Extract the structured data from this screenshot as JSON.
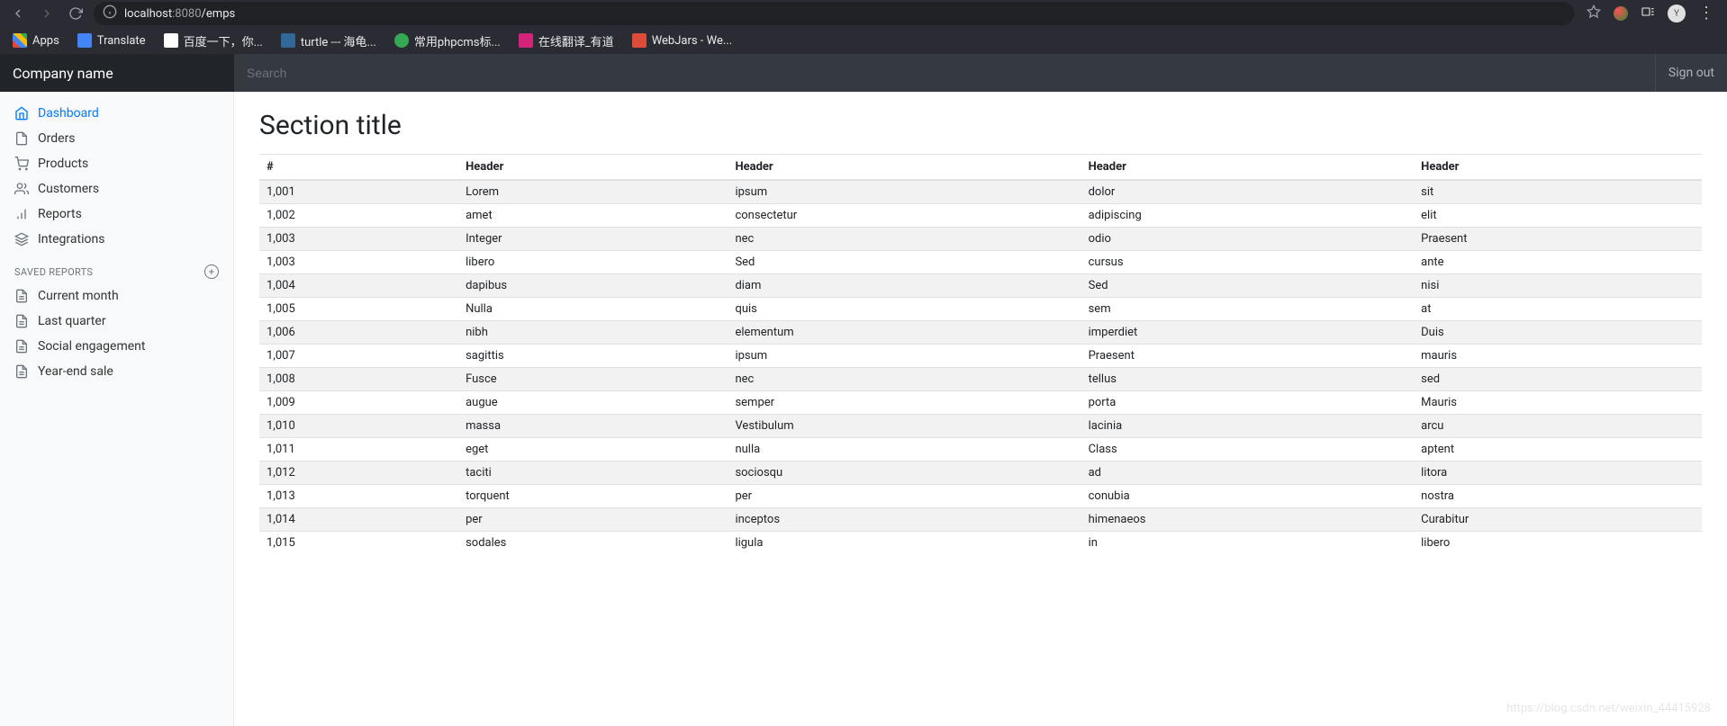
{
  "browser": {
    "url_host": "localhost",
    "url_port": ":8080",
    "url_path": "/emps",
    "bookmarks": [
      {
        "label": "Apps",
        "favicon": "fv-apps"
      },
      {
        "label": "Translate",
        "favicon": "fv-translate"
      },
      {
        "label": "百度一下，你...",
        "favicon": "fv-baidu"
      },
      {
        "label": "turtle --- 海龟...",
        "favicon": "fv-turtle"
      },
      {
        "label": "常用phpcms标...",
        "favicon": "fv-php"
      },
      {
        "label": "在线翻译_有道",
        "favicon": "fv-youdao"
      },
      {
        "label": "WebJars - We...",
        "favicon": "fv-webjars"
      }
    ]
  },
  "navbar": {
    "brand": "Company name",
    "search_placeholder": "Search",
    "signout": "Sign out"
  },
  "sidebar": {
    "main_nav": [
      {
        "label": "Dashboard",
        "icon": "home",
        "active": true
      },
      {
        "label": "Orders",
        "icon": "file",
        "active": false
      },
      {
        "label": "Products",
        "icon": "cart",
        "active": false
      },
      {
        "label": "Customers",
        "icon": "users",
        "active": false
      },
      {
        "label": "Reports",
        "icon": "bar-chart",
        "active": false
      },
      {
        "label": "Integrations",
        "icon": "layers",
        "active": false
      }
    ],
    "saved_heading": "SAVED REPORTS",
    "saved_reports": [
      {
        "label": "Current month"
      },
      {
        "label": "Last quarter"
      },
      {
        "label": "Social engagement"
      },
      {
        "label": "Year-end sale"
      }
    ]
  },
  "content": {
    "title": "Section title",
    "table": {
      "columns": [
        "#",
        "Header",
        "Header",
        "Header",
        "Header"
      ],
      "rows": [
        [
          "1,001",
          "Lorem",
          "ipsum",
          "dolor",
          "sit"
        ],
        [
          "1,002",
          "amet",
          "consectetur",
          "adipiscing",
          "elit"
        ],
        [
          "1,003",
          "Integer",
          "nec",
          "odio",
          "Praesent"
        ],
        [
          "1,003",
          "libero",
          "Sed",
          "cursus",
          "ante"
        ],
        [
          "1,004",
          "dapibus",
          "diam",
          "Sed",
          "nisi"
        ],
        [
          "1,005",
          "Nulla",
          "quis",
          "sem",
          "at"
        ],
        [
          "1,006",
          "nibh",
          "elementum",
          "imperdiet",
          "Duis"
        ],
        [
          "1,007",
          "sagittis",
          "ipsum",
          "Praesent",
          "mauris"
        ],
        [
          "1,008",
          "Fusce",
          "nec",
          "tellus",
          "sed"
        ],
        [
          "1,009",
          "augue",
          "semper",
          "porta",
          "Mauris"
        ],
        [
          "1,010",
          "massa",
          "Vestibulum",
          "lacinia",
          "arcu"
        ],
        [
          "1,011",
          "eget",
          "nulla",
          "Class",
          "aptent"
        ],
        [
          "1,012",
          "taciti",
          "sociosqu",
          "ad",
          "litora"
        ],
        [
          "1,013",
          "torquent",
          "per",
          "conubia",
          "nostra"
        ],
        [
          "1,014",
          "per",
          "inceptos",
          "himenaeos",
          "Curabitur"
        ],
        [
          "1,015",
          "sodales",
          "ligula",
          "in",
          "libero"
        ]
      ]
    }
  },
  "watermark": "https://blog.csdn.net/weixin_44415928"
}
